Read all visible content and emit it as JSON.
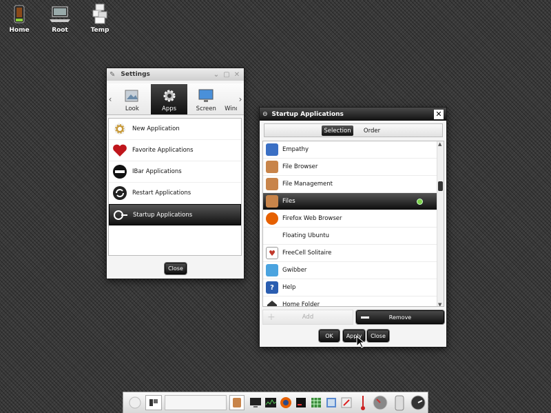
{
  "desktop": {
    "icons": [
      {
        "label": "Home",
        "icon": "trash-bin-icon"
      },
      {
        "label": "Root",
        "icon": "laptop-icon"
      },
      {
        "label": "Temp",
        "icon": "boxes-icon"
      }
    ]
  },
  "settings": {
    "title": "Settings",
    "tabs": [
      {
        "label": "Look",
        "icon": "look-icon"
      },
      {
        "label": "Apps",
        "icon": "apps-gear-icon",
        "active": true
      },
      {
        "label": "Screen",
        "icon": "monitor-icon"
      },
      {
        "label": "Wind",
        "icon": "window-icon"
      }
    ],
    "items": [
      {
        "label": "New Application",
        "icon": "gear-icon"
      },
      {
        "label": "Favorite Applications",
        "icon": "heart-icon"
      },
      {
        "label": "IBar Applications",
        "icon": "ibar-icon"
      },
      {
        "label": "Restart Applications",
        "icon": "restart-icon"
      },
      {
        "label": "Startup Applications",
        "icon": "startup-icon",
        "selected": true
      }
    ],
    "close_label": "Close"
  },
  "startup": {
    "title": "Startup Applications",
    "tabs": {
      "selection": "Selection",
      "order": "Order"
    },
    "apps": [
      {
        "label": "Empathy",
        "icon": "empathy-icon",
        "color": "#3a6fc4"
      },
      {
        "label": "File Browser",
        "icon": "file-browser-icon",
        "color": "#c8844a"
      },
      {
        "label": "File Management",
        "icon": "file-management-icon",
        "color": "#c8844a"
      },
      {
        "label": "Files",
        "icon": "files-icon",
        "color": "#c8844a",
        "selected": true
      },
      {
        "label": "Firefox Web Browser",
        "icon": "firefox-icon",
        "color": "#e66000"
      },
      {
        "label": "Floating Ubuntu",
        "icon": "",
        "color": ""
      },
      {
        "label": "FreeCell Solitaire",
        "icon": "cards-icon",
        "color": "#c0392b"
      },
      {
        "label": "Gwibber",
        "icon": "gwibber-icon",
        "color": "#4aa3df"
      },
      {
        "label": "Help",
        "icon": "help-icon",
        "color": "#2a5db0"
      },
      {
        "label": "Home Folder",
        "icon": "home-folder-icon",
        "color": "#333333"
      }
    ],
    "add_label": "Add",
    "remove_label": "Remove",
    "ok_label": "OK",
    "apply_label": "Apply",
    "close_label": "Close"
  },
  "taskbar": {
    "items": [
      "start-icon",
      "pager-icon",
      "files-icon",
      "terminal-icon",
      "system-monitor-icon",
      "firefox-icon",
      "console-icon",
      "calculator-icon",
      "photos-icon",
      "editor-icon",
      "thermometer-icon",
      "clock-icon",
      "battery-icon",
      "power-icon"
    ]
  }
}
